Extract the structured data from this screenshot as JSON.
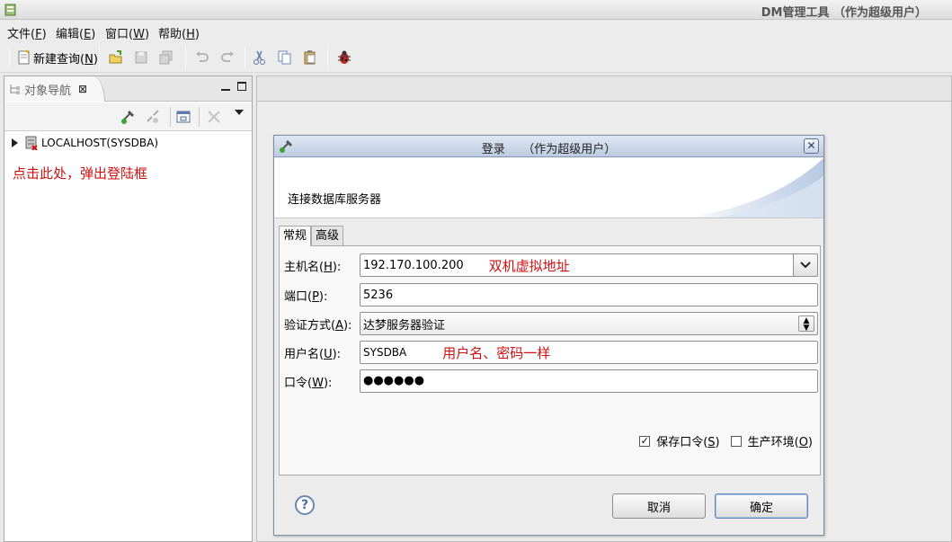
{
  "window": {
    "title": "DM管理工具 （作为超级用户）"
  },
  "menu": [
    {
      "label": "文件(",
      "key": "F",
      "tail": ")"
    },
    {
      "label": "编辑(",
      "key": "E",
      "tail": ")"
    },
    {
      "label": "窗口(",
      "key": "W",
      "tail": ")"
    },
    {
      "label": "帮助(",
      "key": "H",
      "tail": ")"
    }
  ],
  "toolbar": {
    "new_query_prefix": "新建查询(",
    "new_query_key": "N",
    "new_query_suffix": ")"
  },
  "nav": {
    "tab_label": "对象导航",
    "tree_item": "LOCALHOST(SYSDBA)",
    "annotation": "点击此处，弹出登陆框"
  },
  "dialog": {
    "title": "登录　　（作为超级用户）",
    "heading": "连接数据库服务器",
    "tabs": [
      "常规",
      "高级"
    ],
    "host": {
      "label": "主机名(",
      "key": "H",
      "tail": "):",
      "value": "192.170.100.200",
      "note": "双机虚拟地址"
    },
    "port": {
      "label": "端口(",
      "key": "P",
      "tail": "):",
      "value": "5236"
    },
    "auth": {
      "label": "验证方式(",
      "key": "A",
      "tail": "):",
      "value": "达梦服务器验证"
    },
    "user": {
      "label": "用户名(",
      "key": "U",
      "tail": "):",
      "value": "SYSDBA",
      "note": "用户名、密码一样"
    },
    "password": {
      "label": "口令(",
      "key": "W",
      "tail": "):",
      "masked": "●●●●●●"
    },
    "save_pwd": {
      "label": "保存口令(",
      "key": "S",
      "tail": ")",
      "checked": true,
      "check_glyph": "✓"
    },
    "prod_env": {
      "label": "生产环境(",
      "key": "O",
      "tail": ")",
      "checked": false
    },
    "cancel": "取消",
    "ok": "确定"
  },
  "colors": {
    "annotation_red": "#d01010",
    "dialog_title_blue": "#bccbe0"
  }
}
